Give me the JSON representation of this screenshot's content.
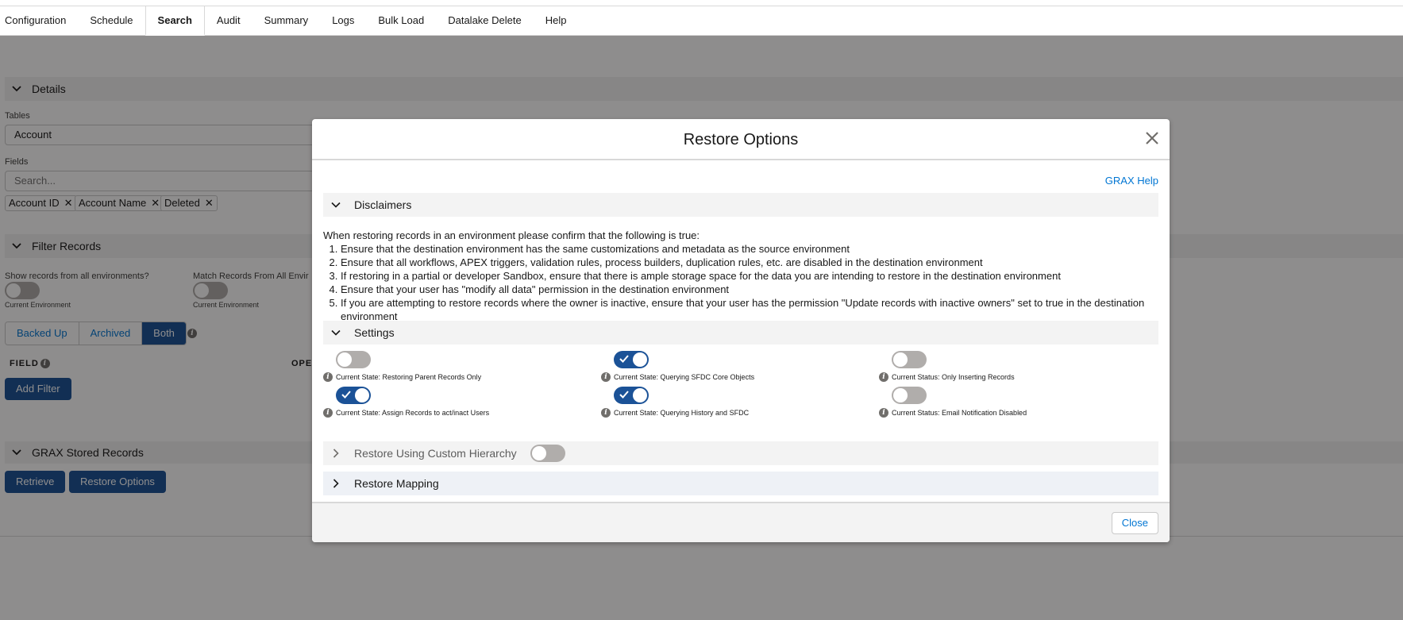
{
  "tabs": [
    "Configuration",
    "Schedule",
    "Search",
    "Audit",
    "Summary",
    "Logs",
    "Bulk Load",
    "Datalake Delete",
    "Help"
  ],
  "active_tab": "Search",
  "details": {
    "section_title": "Details",
    "tables_label": "Tables",
    "tables_value": "Account",
    "fields_label": "Fields",
    "fields_placeholder": "Search...",
    "selected_fields": [
      "Account ID",
      "Account Name",
      "Deleted"
    ]
  },
  "filter": {
    "section_title": "Filter Records",
    "show_all_label": "Show records from all environments?",
    "show_all_caption": "Current Environment",
    "match_label": "Match Records From All Envir",
    "match_caption": "Current Environment",
    "segments": [
      "Backed Up",
      "Archived",
      "Both"
    ],
    "segment_selected": "Both",
    "field_col": "FIELD",
    "op_col": "OPE",
    "add_filter": "Add Filter"
  },
  "stored": {
    "section_title": "GRAX Stored Records",
    "retrieve": "Retrieve",
    "restore_options": "Restore Options"
  },
  "modal": {
    "title": "Restore Options",
    "help_link": "GRAX Help",
    "disclaimers_title": "Disclaimers",
    "disclaimer_intro": "When restoring records in an environment please confirm that the following is true:",
    "disclaimer_items": [
      "Ensure that the destination environment has the same customizations and metadata as the source environment",
      "Ensure that all workflows, APEX triggers, validation rules, process builders, duplication rules, etc. are disabled in the destination environment",
      "If restoring in a partial or developer Sandbox, ensure that there is ample storage space for the data you are intending to restore in the destination environment",
      "Ensure that your user has \"modify all data\" permission in the destination environment",
      "If you are attempting to restore records where the owner is inactive, ensure that your user has the permission \"Update records with inactive owners\" set to true in the destination environment"
    ],
    "settings_title": "Settings",
    "settings": [
      {
        "caption": "Current State: Restoring Parent Records Only",
        "on": false
      },
      {
        "caption": "Current State: Querying SFDC Core Objects",
        "on": true
      },
      {
        "caption": "Current Status: Only Inserting Records",
        "on": false
      },
      {
        "caption": "Current State: Assign Records to act/inact Users",
        "on": true
      },
      {
        "caption": "Current State: Querying History and SFDC",
        "on": true
      },
      {
        "caption": "Current Status: Email Notification Disabled",
        "on": false
      }
    ],
    "custom_hierarchy_title": "Restore Using Custom Hierarchy",
    "custom_hierarchy_on": false,
    "mapping_title": "Restore Mapping",
    "close_label": "Close"
  },
  "colors": {
    "brand_blue": "#1b5297",
    "link_blue": "#0176d3",
    "toggle_off": "#b0adab"
  }
}
